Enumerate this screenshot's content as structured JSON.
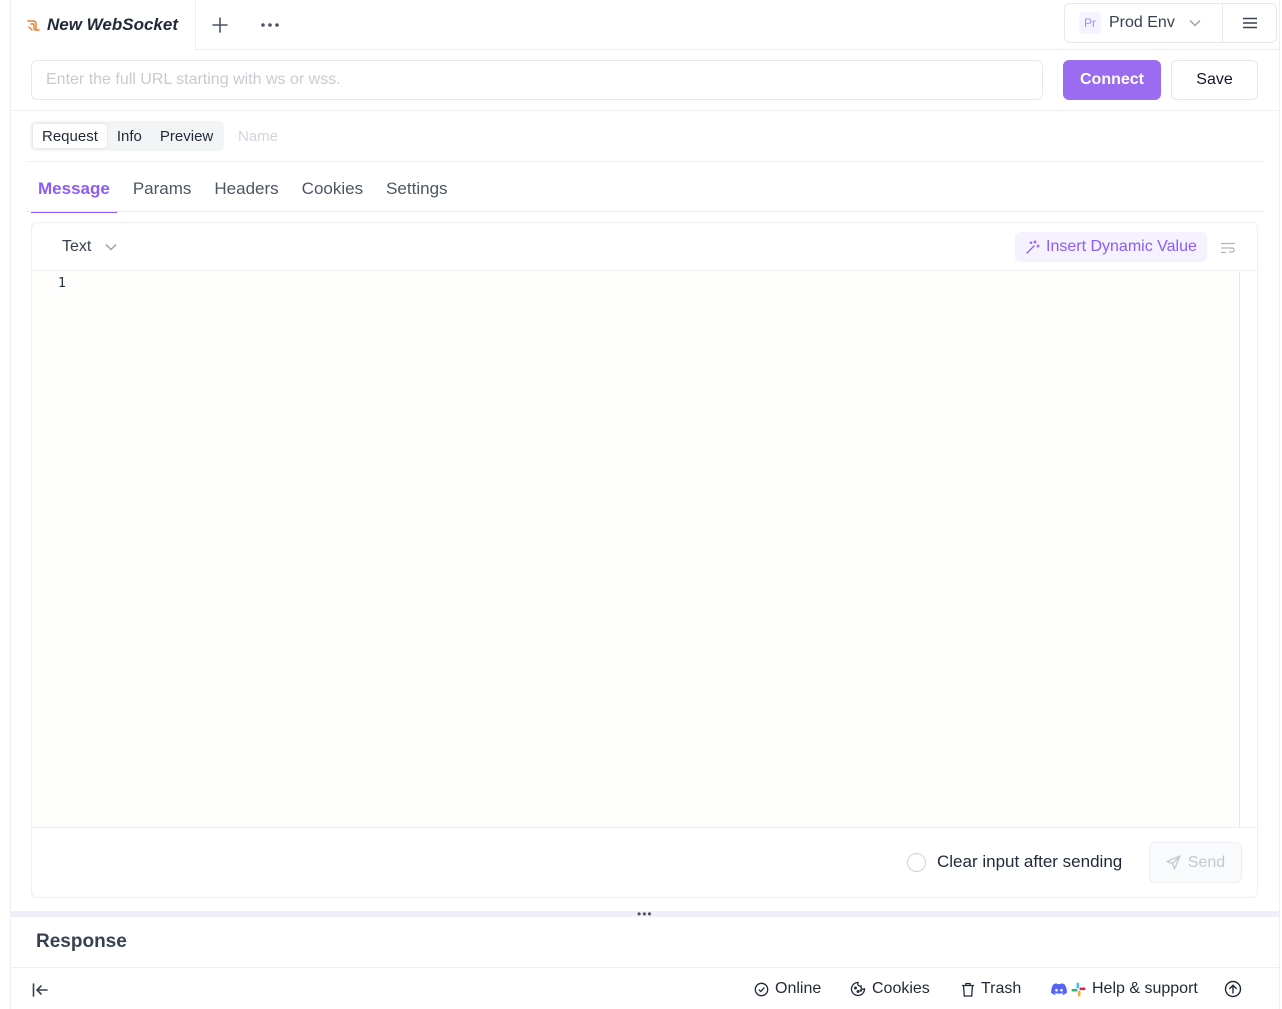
{
  "colors": {
    "accent": "#8b5cf6",
    "connect_bg": "#9b6cf0",
    "dynamic_bg": "#f5f1ff"
  },
  "tab": {
    "title": "New WebSocket",
    "icon": "websocket-icon"
  },
  "header": {
    "add_icon": "plus-icon",
    "more_icon": "ellipsis-icon",
    "menu_icon": "hamburger-icon"
  },
  "env": {
    "badge": "Pr",
    "name": "Prod Env"
  },
  "url": {
    "placeholder": "Enter the full URL starting with ws or wss.",
    "value": ""
  },
  "actions": {
    "connect": "Connect",
    "save": "Save"
  },
  "segments": [
    "Request",
    "Info",
    "Preview"
  ],
  "name_field": {
    "placeholder": "Name"
  },
  "subtabs": [
    "Message",
    "Params",
    "Headers",
    "Cookies",
    "Settings"
  ],
  "editor": {
    "type": "Text",
    "dynamic_value": "Insert Dynamic Value",
    "line_numbers": [
      "1"
    ],
    "clear_input": "Clear input after sending",
    "send": "Send"
  },
  "response": {
    "title": "Response"
  },
  "status": {
    "online": "Online",
    "cookies": "Cookies",
    "trash": "Trash",
    "help": "Help & support"
  }
}
